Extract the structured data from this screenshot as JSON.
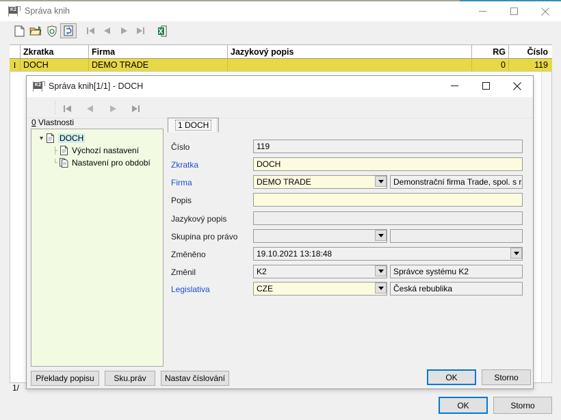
{
  "main_window": {
    "title": "Správa knih",
    "icon": "k2-app-icon",
    "window_controls": {
      "minimize": "minimize-icon",
      "maximize": "maximize-icon",
      "close": "close-icon"
    },
    "toolbar": [
      {
        "name": "new-record-button",
        "icon": "new-document-icon"
      },
      {
        "name": "open-record-button",
        "icon": "open-folder-icon"
      },
      {
        "name": "print-preview-button",
        "icon": "shield-print-icon"
      },
      {
        "name": "refresh-button",
        "icon": "refresh-document-icon",
        "pressed": true
      },
      {
        "name": "first-record-button",
        "icon": "first-record-icon"
      },
      {
        "name": "previous-record-button",
        "icon": "previous-record-icon"
      },
      {
        "name": "next-record-button",
        "icon": "next-record-icon"
      },
      {
        "name": "last-record-button",
        "icon": "last-record-icon"
      },
      {
        "name": "export-excel-button",
        "icon": "excel-export-icon"
      }
    ],
    "grid": {
      "columns": [
        "Zkratka",
        "Firma",
        "Jazykový popis",
        "RG",
        "Číslo"
      ],
      "rows": [
        {
          "Zkratka": "DOCH",
          "Firma": "DEMO TRADE",
          "Jazykový popis": "",
          "RG": "0",
          "Číslo": "119"
        }
      ],
      "row_marker": "I"
    },
    "status": "1/",
    "footer_buttons": [
      {
        "label": "OK",
        "focused": true
      },
      {
        "label": "Storno",
        "focused": false
      }
    ]
  },
  "dialog": {
    "title": "Správa knih[1/1] - DOCH",
    "icon": "k2-app-icon",
    "window_controls": {
      "minimize": "minimize-icon",
      "maximize": "maximize-icon",
      "close": "close-icon"
    },
    "nav_buttons": [
      {
        "name": "first-record-button",
        "icon": "first-record-icon"
      },
      {
        "name": "previous-record-button",
        "icon": "previous-record-icon"
      },
      {
        "name": "next-record-button",
        "icon": "next-record-icon"
      },
      {
        "name": "last-record-button",
        "icon": "last-record-icon"
      }
    ],
    "properties_label": {
      "accesskey": "0",
      "text": " Vlastnosti"
    },
    "tree": [
      {
        "label": "DOCH",
        "level": 0,
        "selected": true,
        "expanded": true,
        "icon": "document-icon"
      },
      {
        "label": "Výchozí nastavení",
        "level": 1,
        "selected": false,
        "icon": "document-icon"
      },
      {
        "label": "Nastavení pro období",
        "level": 1,
        "selected": false,
        "icon": "documents-icon"
      }
    ],
    "tabs": [
      {
        "label": "1 DOCH",
        "active": true
      }
    ],
    "fields": [
      {
        "label": "Číslo",
        "required": false,
        "value": "119",
        "style": "readonly",
        "combo": false,
        "second": null
      },
      {
        "label": "Zkratka",
        "required": true,
        "value": "DOCH",
        "style": "yellow",
        "combo": false,
        "second": null
      },
      {
        "label": "Firma",
        "required": true,
        "value": "DEMO TRADE",
        "style": "yellow",
        "combo": true,
        "second": "Demonstrační firma Trade, spol. s r.o."
      },
      {
        "label": "Popis",
        "required": false,
        "value": "",
        "style": "yellow",
        "combo": false,
        "second": null
      },
      {
        "label": "Jazykový popis",
        "required": false,
        "value": "",
        "style": "gray",
        "combo": false,
        "second": null
      },
      {
        "label": "Skupina pro právo",
        "required": false,
        "value": "",
        "style": "gray",
        "combo": true,
        "second": ""
      },
      {
        "label": "Změněno",
        "required": false,
        "value": "19.10.2021 13:18:48",
        "style": "readonly",
        "combo": true,
        "second": null
      },
      {
        "label": "Změnil",
        "required": false,
        "value": "K2",
        "style": "readonly",
        "combo": true,
        "second": "Správce systému K2"
      },
      {
        "label": "Legislativa",
        "required": true,
        "value": "CZE",
        "style": "yellow",
        "combo": true,
        "second": "Česká rebublika"
      }
    ],
    "action_buttons": [
      {
        "label": "Překlady popisu"
      },
      {
        "label": "Sku.práv"
      },
      {
        "label": "Nastav číslování"
      }
    ],
    "footer_buttons": [
      {
        "label": "OK",
        "focused": true
      },
      {
        "label": "Storno",
        "focused": false
      }
    ]
  },
  "colors": {
    "selection_row": "#e8d843",
    "required_label": "#1b4ec9",
    "focus_border": "#0078d7",
    "tree_panel_bg": "#f2fbe2",
    "tree_selection": "#cfeeee",
    "editable_field": "#fcfbdf",
    "title_accent": "#3a8cb5"
  }
}
